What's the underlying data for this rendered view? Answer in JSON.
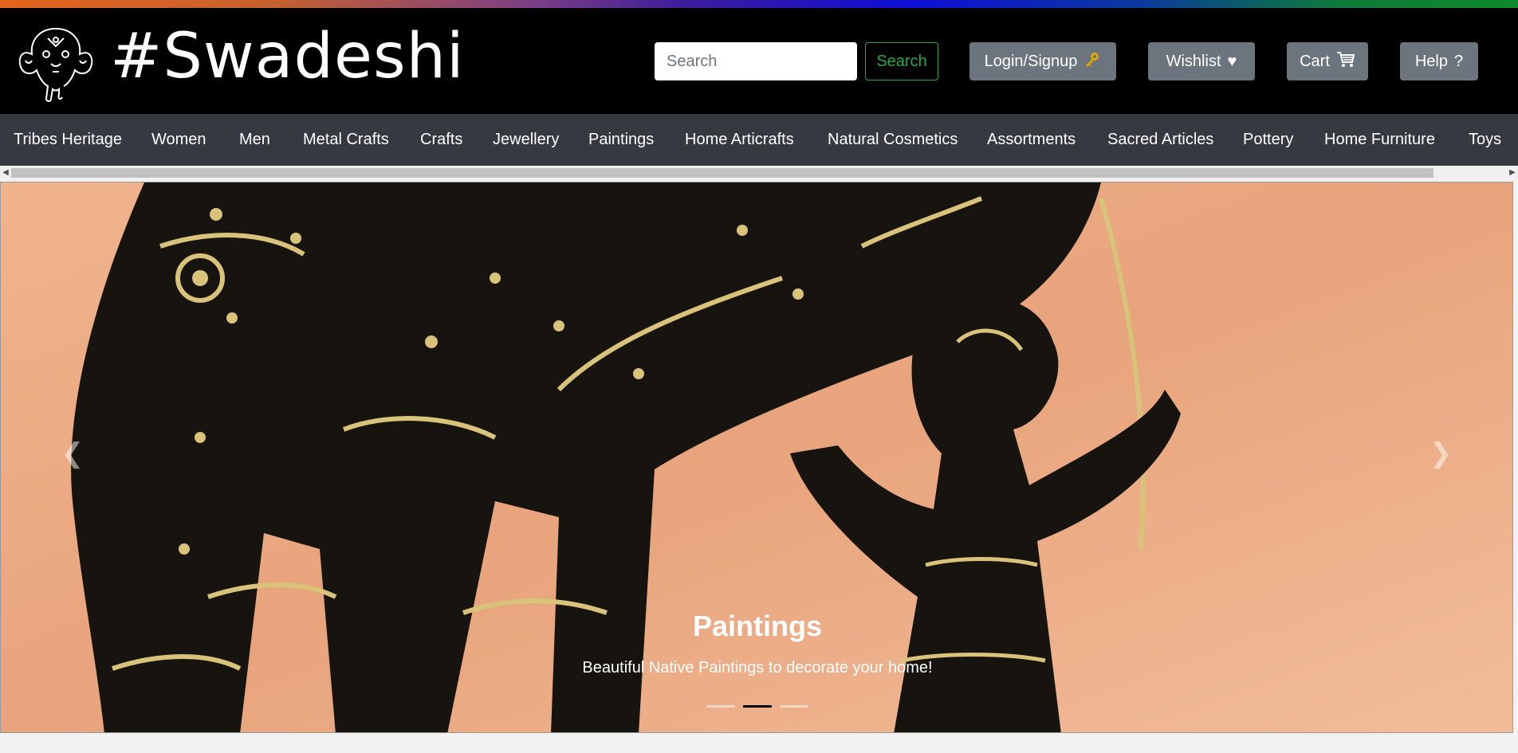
{
  "brand": {
    "name": "#Swadeshi",
    "logo_icon": "elephant-icon"
  },
  "search": {
    "placeholder": "Search",
    "button_label": "Search"
  },
  "header_buttons": [
    {
      "label": "Login/Signup",
      "icon": "key-icon"
    },
    {
      "label": "Wishlist",
      "icon": "heart-icon"
    },
    {
      "label": "Cart",
      "icon": "cart-icon"
    },
    {
      "label": "Help",
      "icon": "question-icon"
    }
  ],
  "categories": [
    "Tribes Heritage",
    "Women",
    "Men",
    "Metal Crafts",
    "Crafts",
    "Jewellery",
    "Paintings",
    "Home Articrafts",
    "Natural Cosmetics",
    "Assortments",
    "Sacred Articles",
    "Pottery",
    "Home Furniture",
    "Toys"
  ],
  "carousel": {
    "title": "Paintings",
    "text": "Beautiful Native Paintings to decorate your home!",
    "slides": 3,
    "active_slide": 2
  },
  "colors": {
    "header_bg": "#000000",
    "nav_bg": "#343a40",
    "search_accent": "#28a745",
    "button_bg": "#6c757d"
  }
}
